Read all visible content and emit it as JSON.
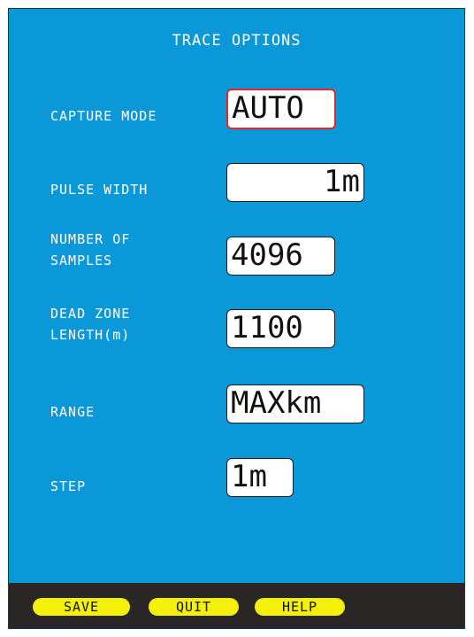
{
  "screen": {
    "title": "TRACE OPTIONS"
  },
  "settings": {
    "capture_mode": {
      "label": "CAPTURE MODE",
      "value": "AUTO"
    },
    "pulse_width": {
      "label": "PULSE WIDTH",
      "value": "1m"
    },
    "number_of_samples": {
      "label_line1": "NUMBER OF",
      "label_line2": "SAMPLES",
      "value": "4096"
    },
    "dead_zone_length": {
      "label_line1": "DEAD ZONE",
      "label_line2": "LENGTH(m)",
      "value": "1100"
    },
    "range": {
      "label": "RANGE",
      "value": "MAXkm"
    },
    "step": {
      "label": "STEP",
      "value": "1m"
    }
  },
  "softkeys": {
    "save": "SAVE",
    "quit": "QUIT",
    "help": "HELP"
  },
  "colors": {
    "background": "#0b98d8",
    "selection_border": "#e0282a",
    "softkey": "#f5f00a",
    "bottom_bar": "#2b2626"
  }
}
